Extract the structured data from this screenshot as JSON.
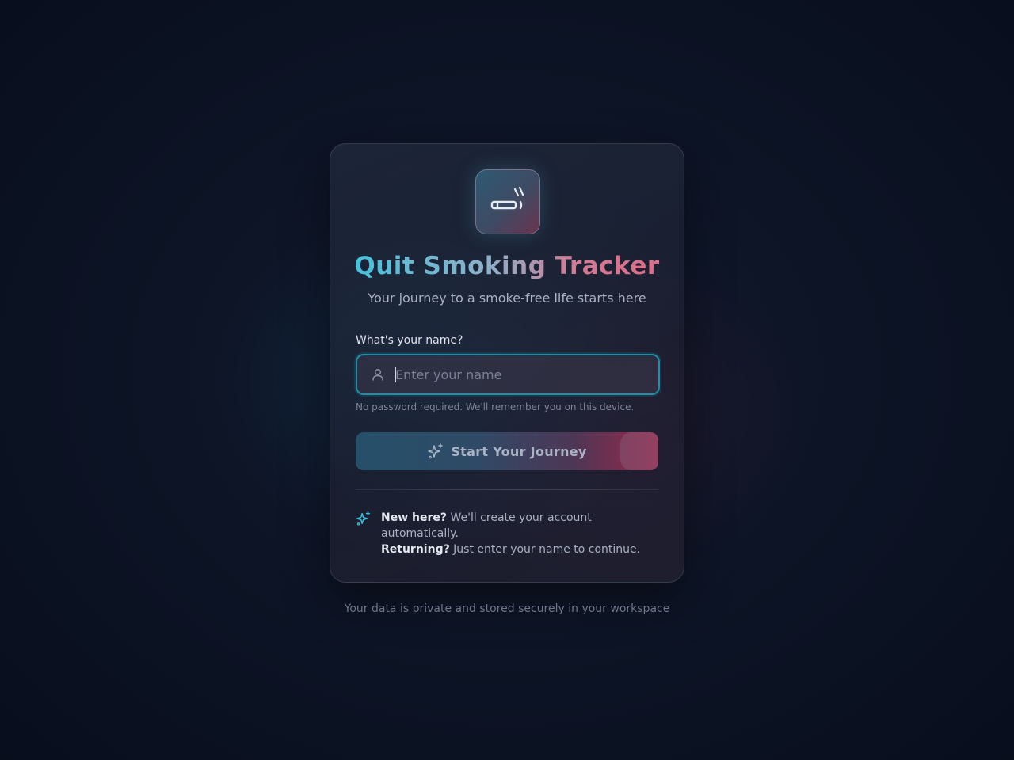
{
  "app": {
    "title": "Quit Smoking Tracker",
    "subtitle": "Your journey to a smoke-free life starts here",
    "logo_icon": "cigarette-icon"
  },
  "login": {
    "name_label": "What's your name?",
    "name_placeholder": "Enter your name",
    "name_value": "",
    "hint": "No password required. We'll remember you on this device.",
    "start_button_label": "Start Your Journey",
    "start_button_icon": "sparkles-icon"
  },
  "info": {
    "icon": "sparkles-icon",
    "new_here_title": "New here?",
    "new_here_text": " We'll create your account automatically.",
    "returning_title": "Returning?",
    "returning_text": " Just enter your name to continue."
  },
  "footer": {
    "privacy_text": "Your data is private and stored securely in your workspace"
  },
  "colors": {
    "accent_cyan": "#3cc3e0",
    "accent_pink": "#e06a86",
    "input_border": "#1f8ea8",
    "background": "#0b1222"
  }
}
